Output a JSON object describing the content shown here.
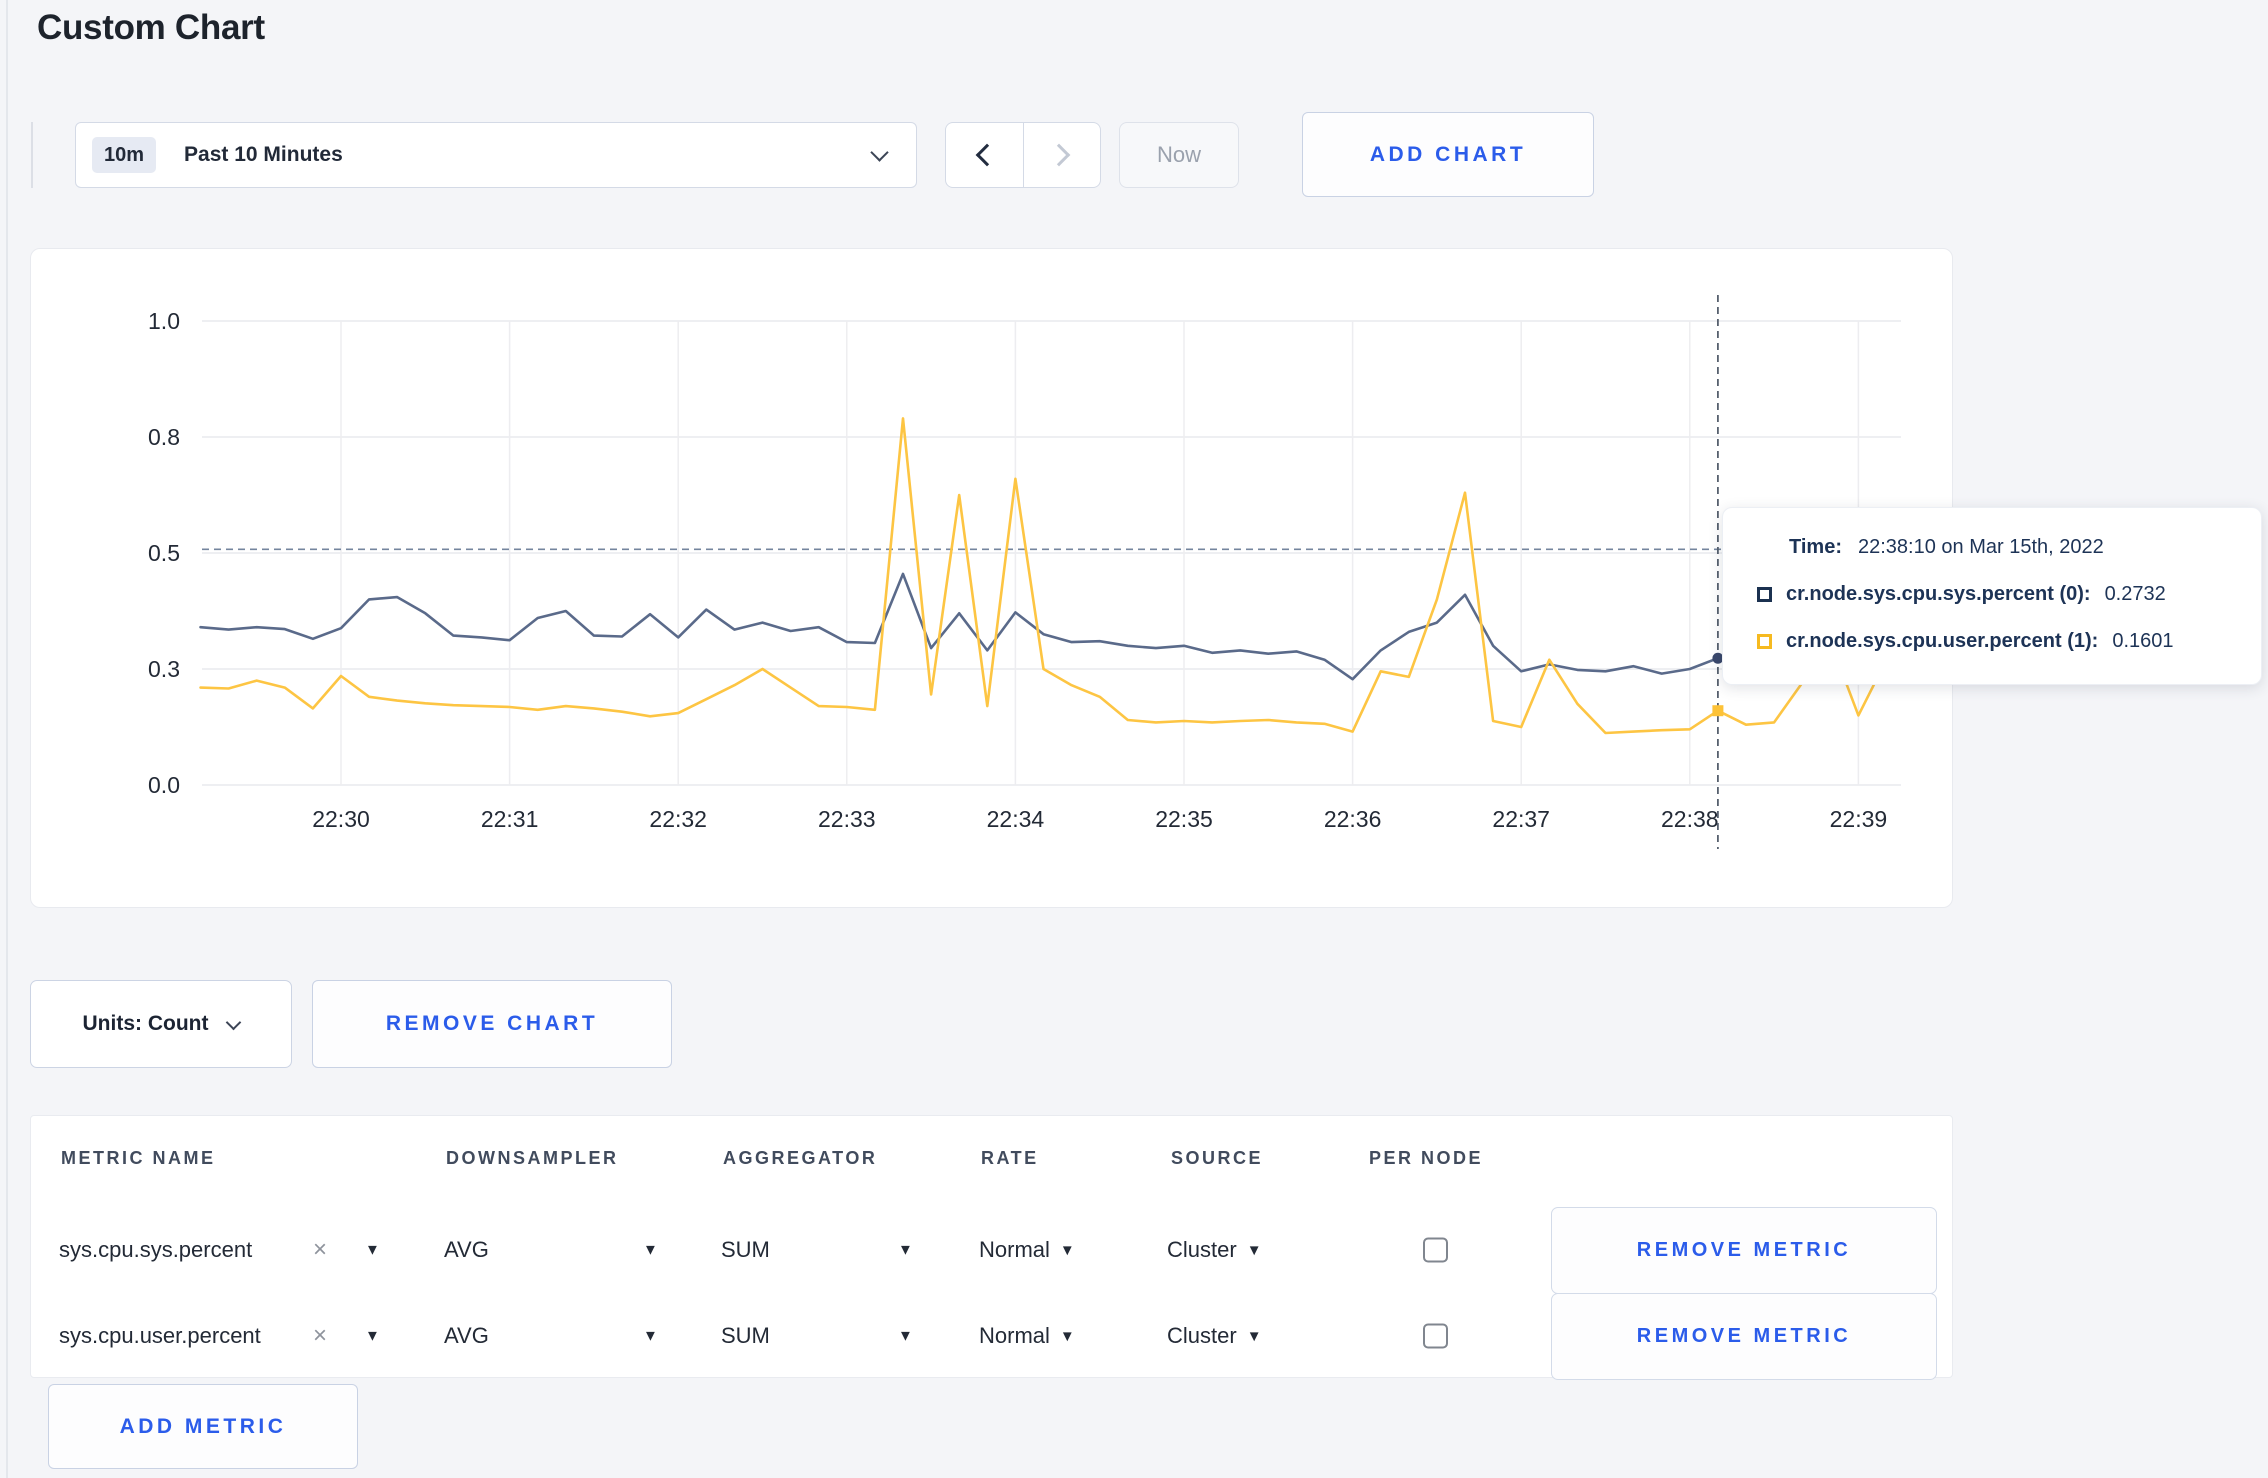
{
  "page": {
    "title": "Custom Chart"
  },
  "toolbar": {
    "time_badge": "10m",
    "time_label": "Past 10 Minutes",
    "prev_icon": "chevron-left",
    "next_icon": "chevron-right",
    "now_label": "Now",
    "add_chart_label": "ADD CHART"
  },
  "colors": {
    "accent_blue": "#2b5cea",
    "navy_text": "#1d3356",
    "page_bg": "#f4f5f8",
    "series_sys_line": "#5a6a8a",
    "series_user_line": "#fdc543",
    "gridline": "#e9eaee"
  },
  "chart_data": {
    "type": "line",
    "title": "",
    "xlabel": "",
    "ylabel": "",
    "ylim": [
      0,
      1
    ],
    "grid": true,
    "x_start": "22:29:10",
    "interval_seconds": 10,
    "x_ticks": [
      "22:30",
      "22:31",
      "22:32",
      "22:33",
      "22:34",
      "22:35",
      "22:36",
      "22:37",
      "22:38",
      "22:39"
    ],
    "y_ticks": [
      {
        "label": "0.0",
        "value": 0.0
      },
      {
        "label": "0.3",
        "value": 0.25
      },
      {
        "label": "0.5",
        "value": 0.5
      },
      {
        "label": "0.8",
        "value": 0.75
      },
      {
        "label": "1.0",
        "value": 1.0
      }
    ],
    "series": [
      {
        "name": "cr.node.sys.cpu.sys.percent",
        "color": "#5a6a8a",
        "values": [
          0.34,
          0.335,
          0.34,
          0.336,
          0.315,
          0.338,
          0.4,
          0.405,
          0.37,
          0.322,
          0.318,
          0.312,
          0.36,
          0.375,
          0.322,
          0.32,
          0.368,
          0.318,
          0.378,
          0.335,
          0.35,
          0.332,
          0.34,
          0.308,
          0.306,
          0.455,
          0.295,
          0.37,
          0.29,
          0.372,
          0.325,
          0.308,
          0.31,
          0.3,
          0.295,
          0.3,
          0.285,
          0.29,
          0.283,
          0.288,
          0.27,
          0.228,
          0.29,
          0.33,
          0.35,
          0.41,
          0.3,
          0.245,
          0.26,
          0.248,
          0.245,
          0.256,
          0.24,
          0.25,
          0.2732,
          0.26,
          0.27,
          0.29,
          0.3,
          0.295,
          0.305
        ]
      },
      {
        "name": "cr.node.sys.cpu.user.percent",
        "color": "#fdc543",
        "values": [
          0.21,
          0.208,
          0.225,
          0.21,
          0.165,
          0.235,
          0.19,
          0.182,
          0.176,
          0.172,
          0.17,
          0.168,
          0.162,
          0.17,
          0.165,
          0.158,
          0.148,
          0.155,
          0.185,
          0.215,
          0.25,
          0.21,
          0.17,
          0.168,
          0.162,
          0.79,
          0.195,
          0.625,
          0.17,
          0.66,
          0.25,
          0.215,
          0.19,
          0.14,
          0.135,
          0.138,
          0.135,
          0.138,
          0.14,
          0.135,
          0.132,
          0.115,
          0.245,
          0.233,
          0.4,
          0.63,
          0.138,
          0.125,
          0.27,
          0.175,
          0.112,
          0.115,
          0.118,
          0.12,
          0.1601,
          0.13,
          0.135,
          0.22,
          0.31,
          0.15,
          0.27
        ]
      }
    ],
    "hover": {
      "index": 54,
      "time": "22:38:10",
      "hline_value": 0.508,
      "values": [
        0.2732,
        0.1601
      ],
      "dot_colors": [
        "#39476b",
        "#fdc237"
      ]
    },
    "legend_position": "tooltip"
  },
  "tooltip": {
    "time_label": "Time:",
    "time_value": "22:38:10 on Mar 15th, 2022",
    "rows": [
      {
        "label": "cr.node.sys.cpu.sys.percent (0):",
        "value": "0.2732",
        "swatch": "#1b3150"
      },
      {
        "label": "cr.node.sys.cpu.user.percent (1):",
        "value": "0.1601",
        "swatch": "#f6ba20"
      }
    ]
  },
  "footer": {
    "units_label": "Units: Count",
    "remove_chart_label": "REMOVE CHART"
  },
  "table": {
    "headers": [
      "METRIC NAME",
      "DOWNSAMPLER",
      "AGGREGATOR",
      "RATE",
      "SOURCE",
      "PER NODE"
    ],
    "rows": [
      {
        "metric": "sys.cpu.sys.percent",
        "clear_icon": "×",
        "downsampler": "AVG",
        "aggregator": "SUM",
        "rate": "Normal",
        "source": "Cluster",
        "per_node_checked": false,
        "remove_label": "REMOVE METRIC"
      },
      {
        "metric": "sys.cpu.user.percent",
        "clear_icon": "×",
        "downsampler": "AVG",
        "aggregator": "SUM",
        "rate": "Normal",
        "source": "Cluster",
        "per_node_checked": false,
        "remove_label": "REMOVE METRIC"
      }
    ],
    "add_metric_label": "ADD METRIC"
  }
}
